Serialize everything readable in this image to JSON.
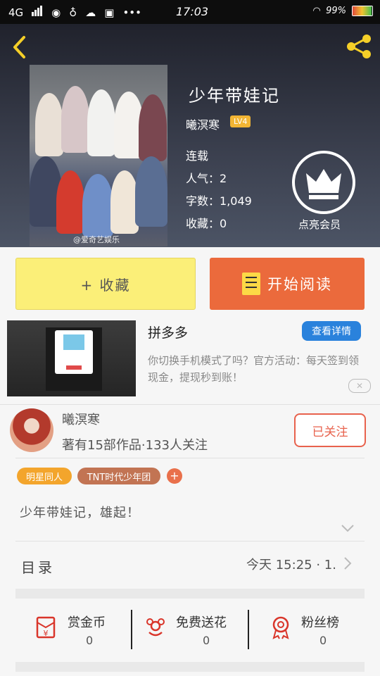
{
  "status_bar": {
    "network": "4G",
    "time": "17:03",
    "battery": "99%"
  },
  "header": {
    "book_title": "少年带娃记",
    "author": "曦溟寒",
    "author_level": "LV4",
    "status": "连载",
    "popularity_label": "人气：",
    "popularity": "2",
    "wordcount_label": "字数：",
    "wordcount": "1,049",
    "favorites_label": "收藏：",
    "favorites": "0",
    "vip_label": "点亮会员",
    "cover_watermark": "@爱奇艺娱乐"
  },
  "actions": {
    "favorite": "+ 收藏",
    "read": "开始阅读"
  },
  "ad": {
    "title": "拼多多",
    "button": "查看详情",
    "description": "你切换手机模式了吗？官方活动：每天签到领现金，提现秒到账！",
    "close": "✕"
  },
  "author_card": {
    "name": "曦溟寒",
    "stats": "著有15部作品·133人关注",
    "follow": "已关注"
  },
  "tags": [
    "明星同人",
    "TNT时代少年团"
  ],
  "tag_add": "+",
  "summary": "少年带娃记，雄起！",
  "toc": {
    "label": "目录",
    "updated": "今天 15:25 · 1."
  },
  "stats": [
    {
      "label": "赏金币",
      "value": "0"
    },
    {
      "label": "免费送花",
      "value": "0"
    },
    {
      "label": "粉丝榜",
      "value": "0"
    }
  ],
  "colors": {
    "accent_yellow": "#f5cf28",
    "read_button": "#eb6a3c",
    "favorite_button": "#fbef78",
    "follow": "#e8624d",
    "stats_icon": "#d9352a"
  }
}
